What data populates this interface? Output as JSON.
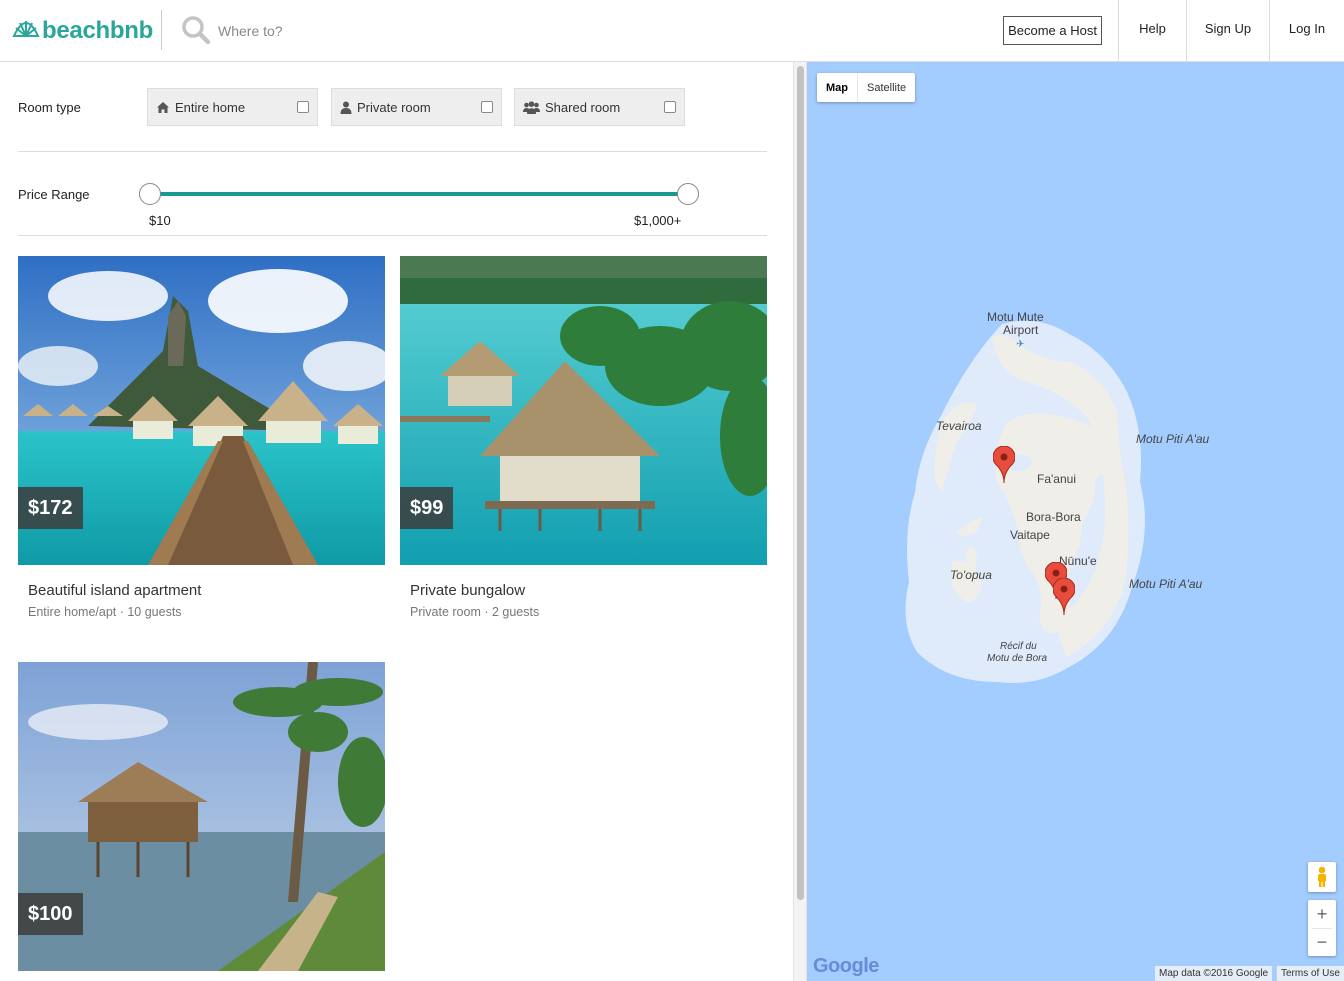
{
  "header": {
    "brand": "beachbnb",
    "search_placeholder": "Where to?",
    "nav": {
      "become_host": "Become a Host",
      "help": "Help",
      "sign_up": "Sign Up",
      "log_in": "Log In"
    }
  },
  "filters": {
    "room_type_label": "Room type",
    "room_types": [
      {
        "label": "Entire home",
        "icon": "home-icon",
        "checked": false
      },
      {
        "label": "Private room",
        "icon": "user-icon",
        "checked": false
      },
      {
        "label": "Shared room",
        "icon": "users-icon",
        "checked": false
      }
    ],
    "price_range_label": "Price Range",
    "price_min": "$10",
    "price_max": "$1,000+"
  },
  "listings": [
    {
      "price": "$172",
      "title": "Beautiful island apartment",
      "subtitle": "Entire home/apt · 10 guests"
    },
    {
      "price": "$99",
      "title": "Private bungalow",
      "subtitle": "Private room · 2 guests"
    },
    {
      "price": "$100",
      "title": "",
      "subtitle": ""
    }
  ],
  "map": {
    "type_map": "Map",
    "type_satellite": "Satellite",
    "labels": {
      "motu_mute": "Motu Mute",
      "airport": "Airport",
      "tevairoa": "Tevairoa",
      "motu_piti_1": "Motu Piti A'au",
      "faanui": "Fa'anui",
      "bora_bora": "Bora-Bora",
      "vaitape": "Vaitape",
      "nunue": "Nūnu'e",
      "topua": "To'opua",
      "motu_piti_2": "Motu Piti A'au",
      "recif_1": "Récif du",
      "recif_2": "Motu de Bora"
    },
    "google": "Google",
    "map_data": "Map data ©2016 Google",
    "terms": "Terms of Use",
    "colors": {
      "water": "#a3ccff",
      "lagoon": "#dfeafb",
      "land": "#efeee9",
      "marker": "#e74c3c"
    }
  },
  "colors": {
    "brand": "#2aa69a",
    "slider": "#169c8f"
  }
}
